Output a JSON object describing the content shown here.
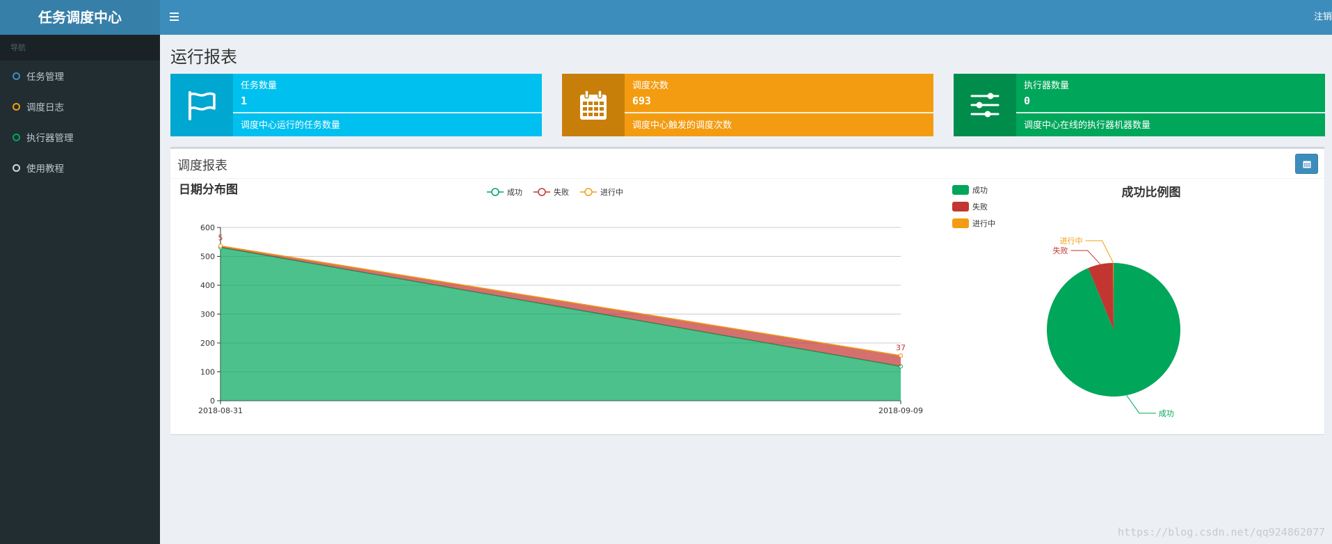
{
  "app": {
    "title": "任务调度中心",
    "logout_label": "注销"
  },
  "sidebar": {
    "header": "导航",
    "items": [
      {
        "label": "任务管理",
        "color": "#3c8dbc"
      },
      {
        "label": "调度日志",
        "color": "#f39c12"
      },
      {
        "label": "执行器管理",
        "color": "#00a65a"
      },
      {
        "label": "使用教程",
        "color": "#d2d6de"
      }
    ]
  },
  "page": {
    "title": "运行报表"
  },
  "stats": [
    {
      "label": "任务数量",
      "value": "1",
      "desc": "调度中心运行的任务数量",
      "icon": "flag-icon",
      "color": "#00c0ef",
      "icon_bg": "#00a7d0"
    },
    {
      "label": "调度次数",
      "value": "693",
      "desc": "调度中心触发的调度次数",
      "icon": "calendar-icon",
      "color": "#f39c12",
      "icon_bg": "#c87f0a"
    },
    {
      "label": "执行器数量",
      "value": "0",
      "desc": "调度中心在线的执行器机器数量",
      "icon": "sliders-icon",
      "color": "#00a65a",
      "icon_bg": "#008d4c"
    }
  ],
  "report": {
    "title": "调度报表",
    "date_button_icon": "calendar-icon"
  },
  "chart_data": [
    {
      "type": "area",
      "title": "日期分布图",
      "stacked": true,
      "categories": [
        "2018-08-31",
        "2018-09-09"
      ],
      "series": [
        {
          "name": "成功",
          "values": [
            531,
            119
          ],
          "color": "#00a65a"
        },
        {
          "name": "失败",
          "values": [
            5,
            37
          ],
          "color": "#c23531"
        },
        {
          "name": "进行中",
          "values": [
            0,
            0
          ],
          "color": "#f39c12"
        }
      ],
      "data_labels": [
        {
          "series": "失败",
          "index": 0,
          "text": "5"
        },
        {
          "series": "失败",
          "index": 1,
          "text": "37"
        }
      ],
      "ylim": [
        0,
        600
      ],
      "yticks": [
        0,
        100,
        200,
        300,
        400,
        500,
        600
      ],
      "legend_position": "top-center",
      "grid": true
    },
    {
      "type": "pie",
      "title": "成功比例图",
      "slices": [
        {
          "name": "成功",
          "value": 650,
          "color": "#00a65a"
        },
        {
          "name": "失败",
          "value": 42,
          "color": "#c23531"
        },
        {
          "name": "进行中",
          "value": 1,
          "color": "#f39c12"
        }
      ],
      "legend_position": "top-left"
    }
  ],
  "watermark": "https://blog.csdn.net/qq924862077"
}
